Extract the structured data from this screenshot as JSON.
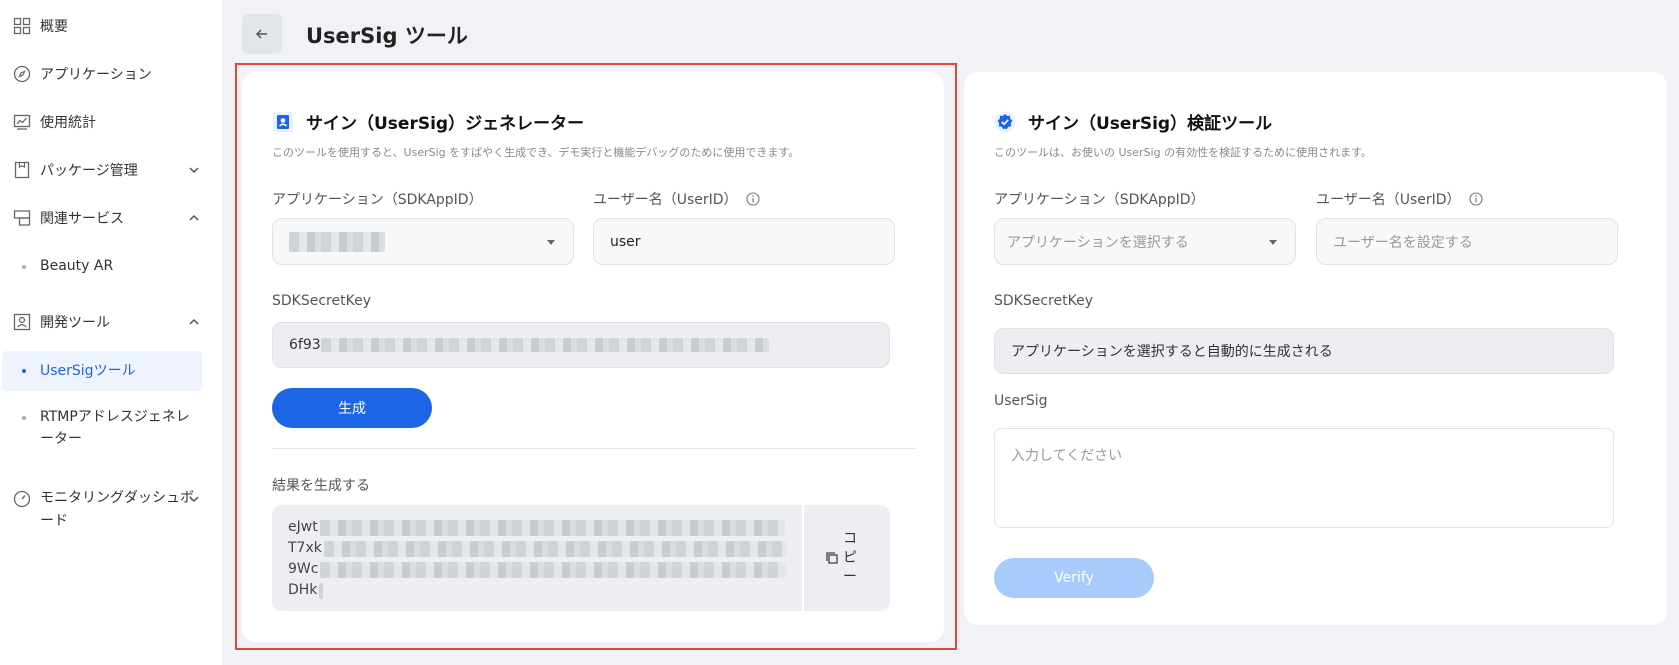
{
  "sidebar": {
    "items": [
      {
        "label": "概要",
        "icon": "grid-icon"
      },
      {
        "label": "アプリケーション",
        "icon": "compass-icon"
      },
      {
        "label": "使用統計",
        "icon": "chart-icon"
      },
      {
        "label": "パッケージ管理",
        "icon": "package-icon"
      },
      {
        "label": "関連サービス",
        "icon": "services-icon"
      },
      {
        "label": "開発ツール",
        "icon": "tools-icon"
      },
      {
        "label": "モニタリングダッシュボード",
        "icon": "gauge-icon"
      }
    ],
    "sub_beauty": "Beauty AR",
    "sub_usersig": "UserSigツール",
    "sub_rtmp": "RTMPアドレスジェネレーター"
  },
  "header": {
    "title": "UserSig ツール"
  },
  "generator": {
    "title": "サイン（UserSig）ジェネレーター",
    "desc": "このツールを使用すると、UserSig をすばやく生成でき、デモ実行と機能デバッグのために使用できます。",
    "app_label": "アプリケーション（SDKAppID）",
    "user_label": "ユーザー名（UserID）",
    "user_value": "user",
    "secret_label": "SDKSecretKey",
    "secret_prefix": "6f93",
    "generate_label": "生成",
    "result_label": "結果を生成する",
    "result_lines": [
      "eJwt",
      "T7xk",
      "9Wc",
      "DHk"
    ],
    "copy_label": "コピー"
  },
  "verifier": {
    "title": "サイン（UserSig）検証ツール",
    "desc": "このツールは、お使いの UserSig の有効性を検証するために使用されます。",
    "app_label": "アプリケーション（SDKAppID）",
    "app_placeholder": "アプリケーションを選択する",
    "user_label": "ユーザー名（UserID）",
    "user_placeholder": "ユーザー名を設定する",
    "secret_label": "SDKSecretKey",
    "secret_value": "アプリケーションを選択すると自動的に生成される",
    "usersig_label": "UserSig",
    "usersig_placeholder": "入力してください",
    "verify_label": "Verify"
  },
  "colors": {
    "accent": "#1c66e5",
    "accent_disabled": "#a9cbfb",
    "highlight": "#e0463a"
  }
}
